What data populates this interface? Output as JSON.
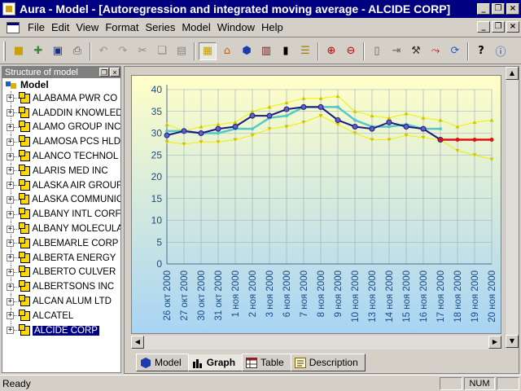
{
  "window": {
    "title": "Aura - Model - [Autoregression and integrated moving average - ALCIDE CORP]"
  },
  "menu": [
    "File",
    "Edit",
    "View",
    "Format",
    "Series",
    "Model",
    "Window",
    "Help"
  ],
  "tree": {
    "header": "Structure of model",
    "root": "Model",
    "items": [
      "ALABAMA PWR CO",
      "ALADDIN KNOWLED",
      "ALAMO GROUP INC",
      "ALAMOSA PCS HLD",
      "ALANCO TECHNOL",
      "ALARIS MED INC",
      "ALASKA AIR GROUF",
      "ALASKA COMMUNIC",
      "ALBANY INTL CORF",
      "ALBANY MOLECULA",
      "ALBEMARLE CORP",
      "ALBERTA ENERGY",
      "ALBERTO CULVER",
      "ALBERTSONS INC",
      "ALCAN ALUM LTD",
      "ALCATEL",
      "ALCIDE CORP"
    ],
    "selected": "ALCIDE CORP"
  },
  "tabs": [
    {
      "label": "Model",
      "icon": "model-hex-icon"
    },
    {
      "label": "Graph",
      "icon": "bar-chart-icon"
    },
    {
      "label": "Table",
      "icon": "table-icon"
    },
    {
      "label": "Description",
      "icon": "description-icon"
    }
  ],
  "active_tab": "Graph",
  "status": {
    "text": "Ready",
    "num": "NUM"
  },
  "colors": {
    "title_bar": "#000080",
    "actual": "#55c8c8",
    "fitted": "#1a1a80",
    "forecast": "#e01010",
    "bounds": "#f0f000",
    "bg_top": "#ffffc8",
    "bg_bottom": "#a8d4f4"
  },
  "chart_data": {
    "type": "line",
    "ylim": [
      0,
      40
    ],
    "yticks": [
      0,
      5,
      10,
      15,
      20,
      25,
      30,
      35,
      40
    ],
    "grid": true,
    "categories": [
      "26 окт 2000",
      "27 окт 2000",
      "30 окт 2000",
      "31 окт 2000",
      "1 ноя 2000",
      "2 ноя 2000",
      "3 ноя 2000",
      "6 ноя 2000",
      "7 ноя 2000",
      "8 ноя 2000",
      "9 ноя 2000",
      "10 ноя 2000",
      "13 ноя 2000",
      "14 ноя 2000",
      "15 ноя 2000",
      "16 ноя 2000",
      "17 ноя 2000",
      "18 ноя 2000",
      "19 ноя 2000",
      "20 ноя 2000"
    ],
    "series": [
      {
        "role": "actual",
        "values": [
          30.5,
          30.5,
          30,
          30,
          31,
          31,
          33.5,
          34,
          36,
          36,
          36,
          33,
          31.5,
          31.5,
          32,
          31,
          31,
          null,
          null,
          null
        ]
      },
      {
        "role": "fitted",
        "values": [
          29.5,
          30.5,
          30,
          31,
          31.5,
          34,
          34,
          35.5,
          36,
          36,
          33,
          31.5,
          31,
          32.5,
          31.5,
          31,
          28.5,
          null,
          null,
          null
        ]
      },
      {
        "role": "forecast",
        "values": [
          null,
          null,
          null,
          null,
          null,
          null,
          null,
          null,
          null,
          null,
          null,
          null,
          null,
          null,
          null,
          null,
          28.5,
          28.5,
          28.5,
          28.5
        ]
      },
      {
        "role": "upper",
        "values": [
          32,
          30.5,
          31.5,
          32,
          32.5,
          35,
          36,
          37,
          38,
          38,
          38.5,
          35,
          34,
          33.5,
          34.5,
          33.5,
          33,
          31.5,
          32.5,
          33
        ]
      },
      {
        "role": "lower",
        "values": [
          28,
          27.5,
          28,
          28,
          28.5,
          29.5,
          31,
          31.5,
          32.5,
          34,
          32,
          30,
          28.5,
          28.5,
          29.5,
          29,
          28.5,
          26,
          25,
          24
        ]
      }
    ]
  }
}
